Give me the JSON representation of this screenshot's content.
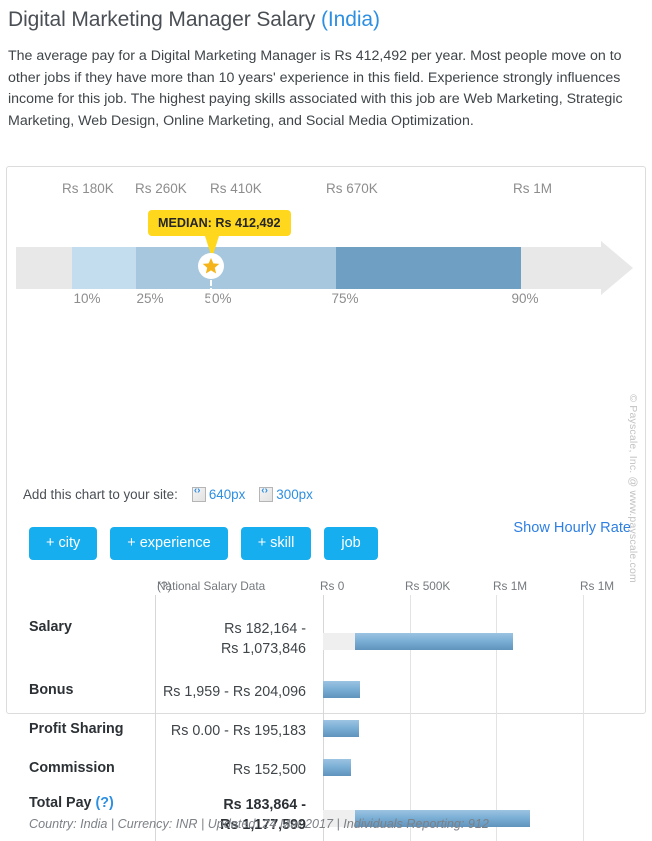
{
  "header": {
    "title": "Digital Marketing Manager Salary",
    "region": "(India)"
  },
  "intro": "The average pay for a Digital Marketing Manager is Rs 412,492 per year. Most people move on to other jobs if they have more than 10 years' experience in this field. Experience strongly influences income for this job. The highest paying skills associated with this job are Web Marketing, Strategic Marketing, Web Design, Online Marketing, and Social Media Optimization.",
  "percentile_chart": {
    "median_callout": "MEDIAN: Rs 412,492",
    "top_labels": [
      "Rs 180K",
      "Rs 260K",
      "Rs 410K",
      "Rs 670K",
      "Rs 1M"
    ],
    "tick_labels": [
      "10%",
      "25%",
      "50%",
      "75%",
      "90%"
    ],
    "colors": {
      "track_gray": "#e8e8e8",
      "light_blue": "#c3dcee",
      "mid_blue": "#a6c7de",
      "dark_blue": "#6f9fc3",
      "callout_yellow": "#ffd71d"
    }
  },
  "embed": {
    "label": "Add this chart to your site:",
    "option_640": "640px",
    "option_300": "300px",
    "icon_640": "embed-code-icon",
    "icon_300": "embed-code-icon"
  },
  "filters": {
    "buttons": [
      "+ city",
      "+ experience",
      "+ skill",
      "job"
    ],
    "hourly_link": "Show Hourly Rate"
  },
  "chart_data": {
    "type": "bar",
    "title": "National Salary Data",
    "help_marker": "(?)",
    "xlabel": "",
    "ylabel": "",
    "axis_tick_labels": [
      "Rs 0",
      "Rs 500K",
      "Rs 1M",
      "Rs 1M"
    ],
    "xlim": [
      0,
      1400000
    ],
    "grid": true,
    "legend": "none",
    "categories": [
      "Salary",
      "Bonus",
      "Profit Sharing",
      "Commission",
      "Total Pay"
    ],
    "rows": [
      {
        "label": "Salary",
        "value_lines": [
          "Rs 182,164 -",
          "Rs 1,073,846"
        ],
        "low": 182164,
        "high": 1073846,
        "bold": false,
        "help_marker": ""
      },
      {
        "label": "Bonus",
        "value_lines": [
          "Rs 1,959 - Rs 204,096"
        ],
        "low": 1959,
        "high": 204096,
        "bold": false,
        "help_marker": ""
      },
      {
        "label": "Profit Sharing",
        "value_lines": [
          "Rs 0.00 - Rs 195,183"
        ],
        "low": 0,
        "high": 195183,
        "bold": false,
        "help_marker": ""
      },
      {
        "label": "Commission",
        "value_lines": [
          "Rs 152,500"
        ],
        "low": 0,
        "high": 152500,
        "bold": false,
        "help_marker": ""
      },
      {
        "label": "Total Pay",
        "value_lines": [
          "Rs 183,864 -",
          "Rs 1,177,599"
        ],
        "low": 183864,
        "high": 1177599,
        "bold": true,
        "help_marker": "(?)"
      }
    ]
  },
  "footer": {
    "note": "Country: India | Currency: INR | Updated: 24 Mar 2017 | Individuals Reporting: 912",
    "watermark": "© Payscale, Inc. @ www.payscale.com"
  }
}
